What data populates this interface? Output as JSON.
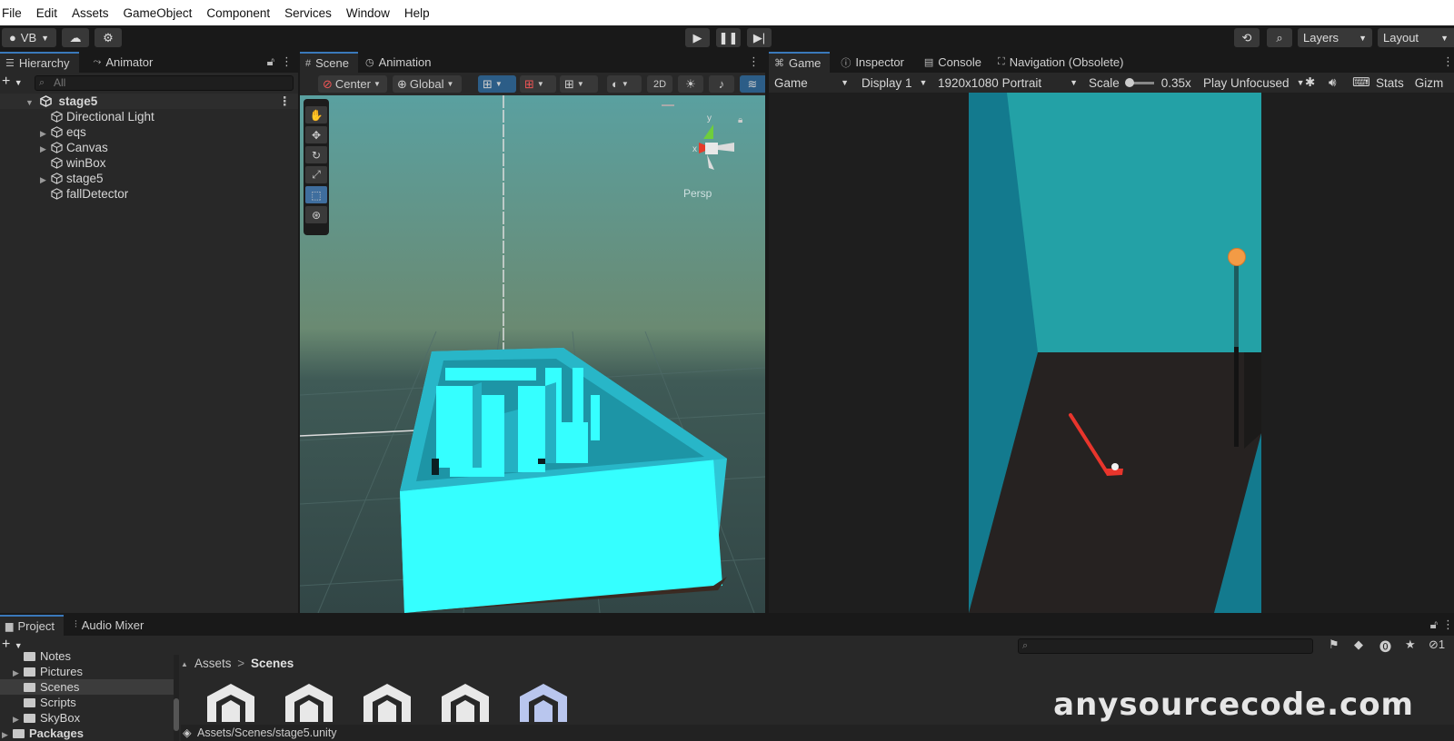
{
  "menu": [
    "File",
    "Edit",
    "Assets",
    "GameObject",
    "Component",
    "Services",
    "Window",
    "Help"
  ],
  "toolbar": {
    "account": "VB",
    "layers_label": "Layers",
    "layout_label": "Layout"
  },
  "hierarchy": {
    "tabs": [
      "Hierarchy",
      "Animator"
    ],
    "search_placeholder": "All",
    "root": "stage5",
    "items": [
      {
        "label": "Directional Light",
        "expandable": false
      },
      {
        "label": "eqs",
        "expandable": true
      },
      {
        "label": "Canvas",
        "expandable": true
      },
      {
        "label": "winBox",
        "expandable": false
      },
      {
        "label": "stage5",
        "expandable": true
      },
      {
        "label": "fallDetector",
        "expandable": false
      }
    ]
  },
  "scene": {
    "tabs": [
      "Scene",
      "Animation"
    ],
    "pivot": "Center",
    "space": "Global",
    "mode_2d": "2D",
    "gizmo_axis": "x",
    "gizmo_y": "y",
    "persp": "Persp"
  },
  "game": {
    "tabs": [
      "Game",
      "Inspector",
      "Console",
      "Navigation (Obsolete)"
    ],
    "view": "Game",
    "display": "Display 1",
    "resolution": "1920x1080 Portrait",
    "scale_label": "Scale",
    "scale_value": "0.35x",
    "play_mode": "Play Unfocused",
    "stats": "Stats",
    "gizmos": "Gizm"
  },
  "project": {
    "tabs": [
      "Project",
      "Audio Mixer"
    ],
    "folders": [
      {
        "label": "Notes",
        "expandable": false,
        "selected": false
      },
      {
        "label": "Pictures",
        "expandable": true,
        "selected": false
      },
      {
        "label": "Scenes",
        "expandable": false,
        "selected": true
      },
      {
        "label": "Scripts",
        "expandable": false,
        "selected": false
      },
      {
        "label": "SkyBox",
        "expandable": true,
        "selected": false
      },
      {
        "label": "Packages",
        "expandable": true,
        "selected": false
      }
    ],
    "breadcrumb_root": "Assets",
    "breadcrumb_current": "Scenes",
    "hidden_count": "1",
    "selected_path": "Assets/Scenes/stage5.unity"
  },
  "watermark": "anysourcecode.com",
  "colors": {
    "maze": "#35ffff",
    "accent_tab": "#3a79bb",
    "game_wall": "#137a8e",
    "game_floor": "#262221",
    "game_sky": "#23a1a6",
    "club": "#e8352c",
    "ball_marker": "#f39b45"
  }
}
